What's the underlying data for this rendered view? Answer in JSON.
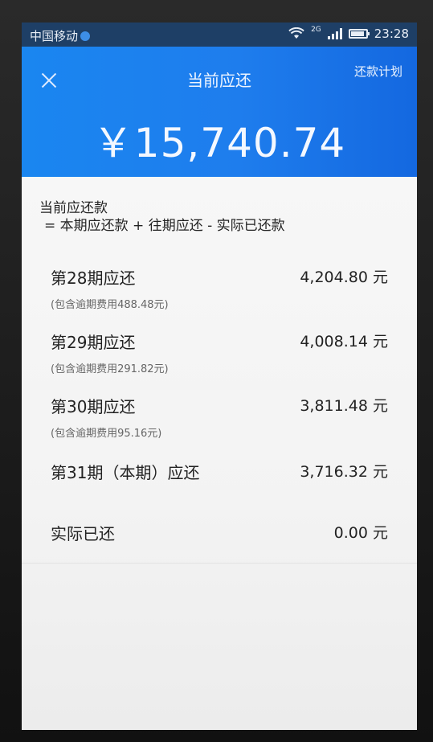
{
  "status_bar": {
    "carrier": "中国移动",
    "network": "2G",
    "time": "23:28"
  },
  "header": {
    "title": "当前应还",
    "plan_link": "还款计划",
    "amount": "￥15,740.74"
  },
  "formula": {
    "line1": "当前应还款",
    "line2": "= 本期应还款 + 往期应还 - 实际已还款"
  },
  "rows": [
    {
      "label": "第28期应还",
      "value": "4,204.80 元",
      "note": "(包含逾期费用488.48元)"
    },
    {
      "label": "第29期应还",
      "value": "4,008.14 元",
      "note": "(包含逾期费用291.82元)"
    },
    {
      "label": "第30期应还",
      "value": "3,811.48 元",
      "note": "(包含逾期费用95.16元)"
    },
    {
      "label": "第31期（本期）应还",
      "value": "3,716.32 元",
      "note": ""
    }
  ],
  "paid": {
    "label": "实际已还",
    "value": "0.00 元"
  },
  "icons": {
    "close": "close-icon",
    "wifi": "wifi-icon",
    "signal": "signal-icon",
    "battery": "battery-icon"
  },
  "colors": {
    "header_blue": "#1a86f0",
    "status_bar": "#1e3f66"
  }
}
